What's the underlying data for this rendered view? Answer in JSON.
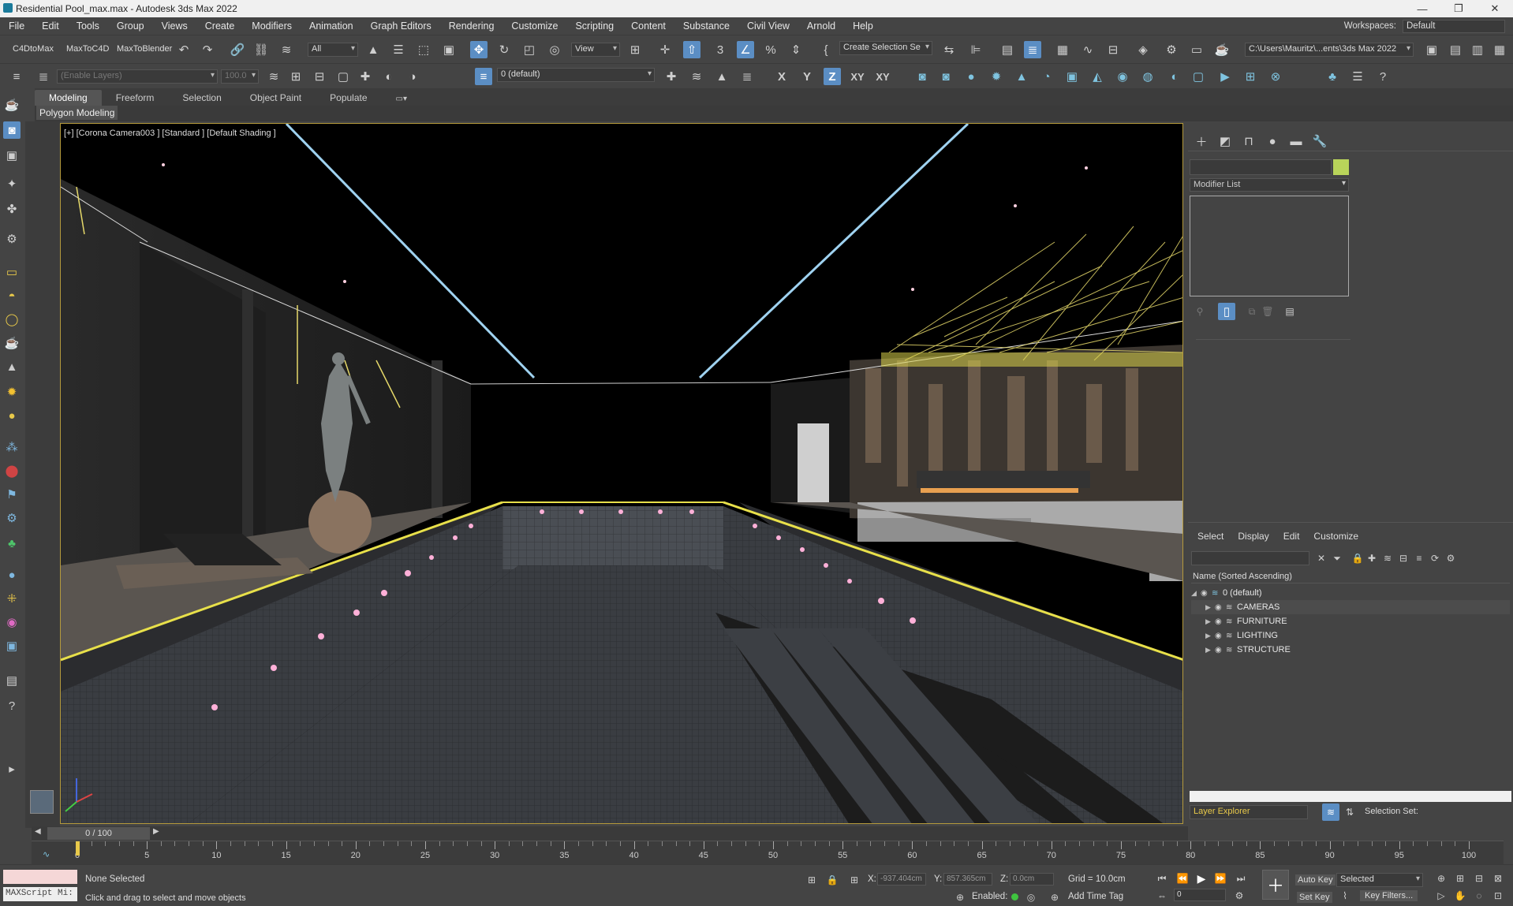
{
  "window": {
    "title": "Residential Pool_max.max - Autodesk 3ds Max 2022",
    "controls": [
      "—",
      "❐",
      "✕"
    ]
  },
  "menu": {
    "items": [
      "File",
      "Edit",
      "Tools",
      "Group",
      "Views",
      "Create",
      "Modifiers",
      "Animation",
      "Graph Editors",
      "Rendering",
      "Customize",
      "Scripting",
      "Content",
      "Substance",
      "Civil View",
      "Arnold",
      "Help"
    ],
    "workspaces_label": "Workspaces:",
    "workspaces_value": "Default"
  },
  "toolbar1": {
    "c4dtomax": "C4DtoMax",
    "maxtoc4d": "MaxToC4D",
    "maxtoblender": "MaxToBlender",
    "selection_filter": "All",
    "ref_coord": "View",
    "named_selection": "Create Selection Se",
    "project_path": "C:\\Users\\Mauritz\\...ents\\3ds Max 2022"
  },
  "toolbar2": {
    "layer_dropdown": "(Enable Layers)",
    "layer_value": "100.0",
    "current_layer": "0 (default)",
    "axis_x": "X",
    "axis_y": "Y",
    "axis_z": "Z",
    "axis_xy": "XY",
    "axis_xy2": "XY"
  },
  "ribbon": {
    "tabs": [
      "Modeling",
      "Freeform",
      "Selection",
      "Object Paint",
      "Populate"
    ],
    "active_panel": "Polygon Modeling"
  },
  "viewport": {
    "label": "[+] [Corona Camera003 ] [Standard ] [Default Shading ]"
  },
  "command_panel": {
    "modifier_list": "Modifier List"
  },
  "scene_explorer": {
    "menus": [
      "Select",
      "Display",
      "Edit",
      "Customize"
    ],
    "column_header": "Name (Sorted Ascending)",
    "root_layer": "0 (default)",
    "layers": [
      "CAMERAS",
      "FURNITURE",
      "LIGHTING",
      "STRUCTURE"
    ],
    "explorer_type": "Layer Explorer",
    "selection_set_label": "Selection Set:"
  },
  "timeline": {
    "frame_display": "0 / 100",
    "tick_labels": [
      "0",
      "5",
      "10",
      "15",
      "20",
      "25",
      "30",
      "35",
      "40",
      "45",
      "50",
      "55",
      "60",
      "65",
      "70",
      "75",
      "80",
      "85",
      "90",
      "95",
      "100"
    ]
  },
  "status": {
    "maxscript_label": "MAXScript Mi:",
    "selection_status": "None Selected",
    "prompt": "Click and drag to select and move objects",
    "x_label": "X:",
    "x_value": "-937.404cm",
    "y_label": "Y:",
    "y_value": "857.365cm",
    "z_label": "Z:",
    "z_value": "0.0cm",
    "grid": "Grid = 10.0cm",
    "enabled_label": "Enabled:",
    "add_time_tag": "Add Time Tag",
    "auto_key": "Auto Key",
    "set_key": "Set Key",
    "key_mode": "Selected",
    "key_filters": "Key Filters...",
    "frame_value": "0"
  }
}
